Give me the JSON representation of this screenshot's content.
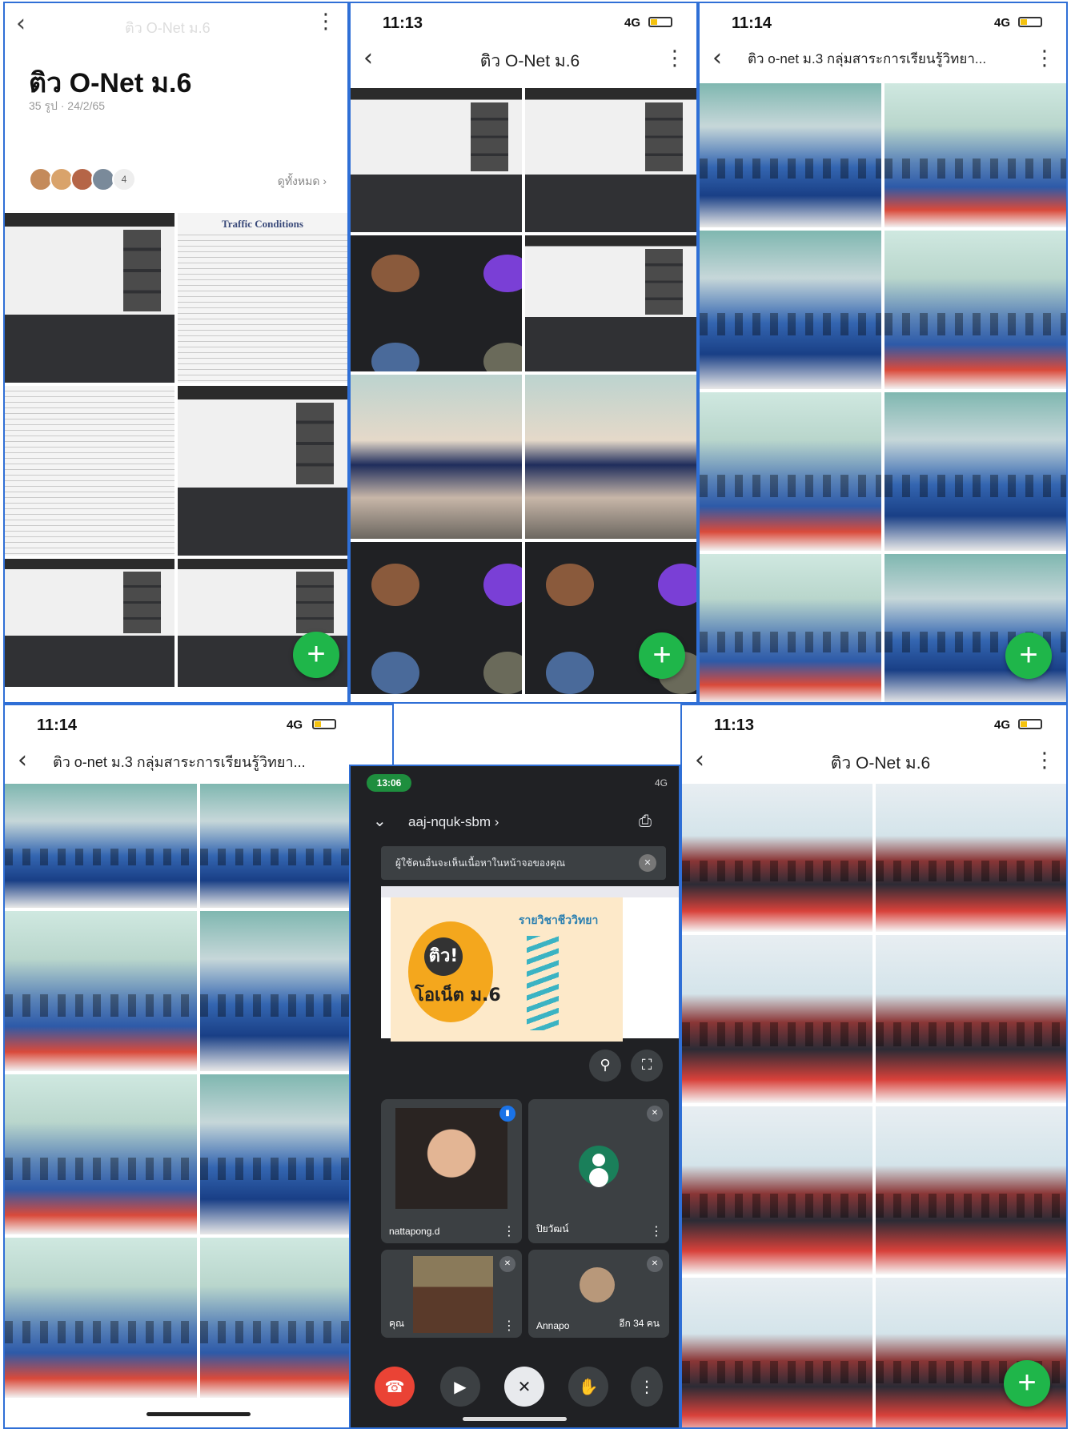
{
  "panel1": {
    "faded_title": "ติว O-Net ม.6",
    "title": "ติว O-Net ม.6",
    "meta": "35 รูป · 24/2/65",
    "avatars_count": "4",
    "see_all": "ดูทั้งหมด ›",
    "doc_heading": "Traffic Conditions",
    "fab": "+"
  },
  "panel2": {
    "time": "11:13",
    "signal": "4G",
    "title": "ติว O-Net ม.6",
    "fab": "+"
  },
  "panel3": {
    "time": "11:14",
    "signal": "4G",
    "title": "ติว o-net ม.3 กลุ่มสาระการเรียนรู้วิทยา...",
    "fab": "+"
  },
  "panel4": {
    "time": "11:14",
    "signal": "4G",
    "title": "ติว o-net ม.3 กลุ่มสาระการเรียนรู้วิทยา..."
  },
  "panel5": {
    "time": "13:06",
    "signal": "4G",
    "meeting_code": "aaj-nquk-sbm ›",
    "banner": "ผู้ใช้คนอื่นจะเห็นเนื้อหาในหน้าจอของคุณ",
    "poster_title1": "ติว!",
    "poster_title2": "โอเน็ต ม.6",
    "poster_subject": "รายวิชาชีววิทยา",
    "participants": [
      {
        "name": "nattapong.d"
      },
      {
        "name": "ปิยวัฒน์"
      },
      {
        "name": "คุณ"
      },
      {
        "name": "Annapo",
        "extra": "อีก 34 คน"
      }
    ]
  },
  "panel6": {
    "time": "11:13",
    "signal": "4G",
    "title": "ติว O-Net ม.6",
    "fab": "+"
  }
}
